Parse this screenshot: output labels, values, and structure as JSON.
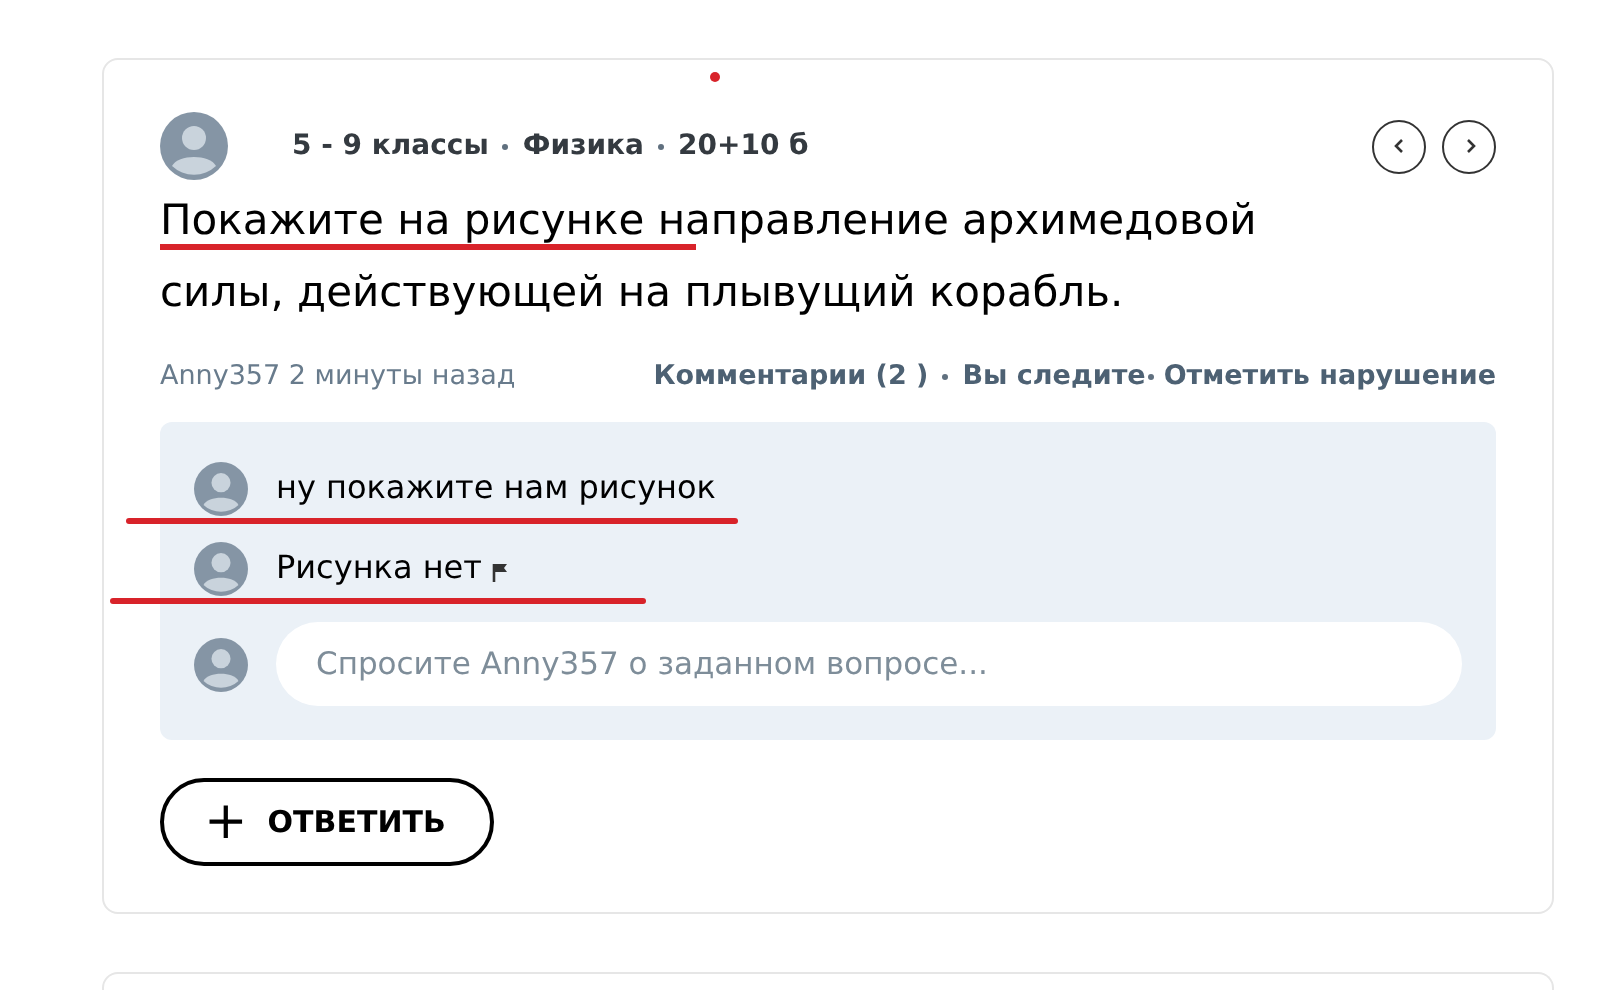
{
  "question": {
    "grade": "5 - 9 классы",
    "subject": "Физика",
    "points": "20+10 б",
    "text": "Покажите на рисунке направление архимедовой силы, действующей на плывущий корабль.",
    "author": "Anny357",
    "time": "2 минуты назад",
    "actions": [
      "Комментарии (2 )",
      "Вы следите",
      "Отметить нарушение"
    ]
  },
  "comments": [
    {
      "text": "ну покажите нам рисунок",
      "flag": false
    },
    {
      "text": "Рисунка нет",
      "flag": true
    }
  ],
  "comment_field": {
    "placeholder": "Спросите Anny357 о заданном вопросе..."
  },
  "answer_button": {
    "icon": "+",
    "label": "ОТВЕТИТЬ"
  }
}
